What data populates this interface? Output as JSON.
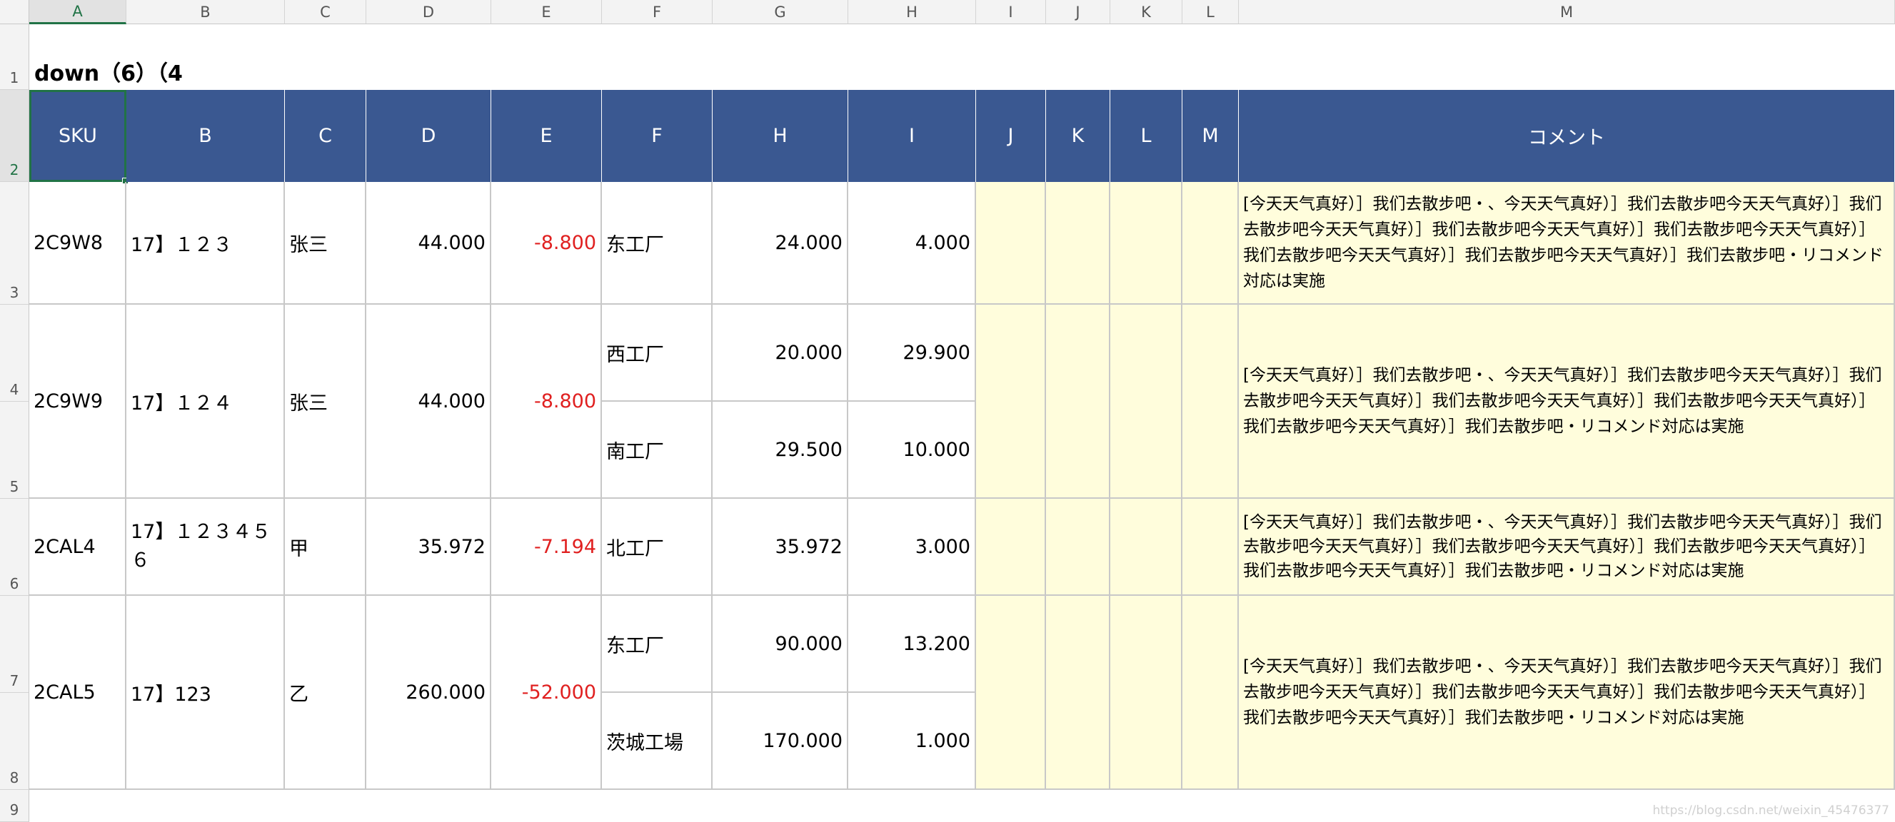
{
  "sheet": {
    "column_letters": [
      "A",
      "B",
      "C",
      "D",
      "E",
      "F",
      "G",
      "H",
      "I",
      "J",
      "K",
      "L",
      "M"
    ],
    "row_numbers": [
      "1",
      "2",
      "3",
      "4",
      "5",
      "6",
      "7",
      "8",
      "9"
    ],
    "title": "down（6）（4",
    "headers": [
      "SKU",
      "B",
      "C",
      "D",
      "E",
      "F",
      "H",
      "I",
      "J",
      "K",
      "L",
      "M",
      "コメント"
    ],
    "rows": [
      {
        "sku": "2C9W8",
        "b": "17】１２３",
        "c": "张三",
        "d": "44.000",
        "e": "-8.800",
        "plants": [
          {
            "f": "东工厂",
            "h": "24.000",
            "i": "4.000"
          }
        ],
        "comment": "[今天天气真好）］我们去散步吧・、今天天气真好）］我们去散步吧今天天气真好）］我们去散步吧今天天气真好）］我们去散步吧今天天气真好）］我们去散步吧今天天气真好）］我们去散步吧今天天气真好）］我们去散步吧今天天气真好）］我们去散步吧・リコメンド対応は実施"
      },
      {
        "sku": "2C9W9",
        "b": "17】１２４",
        "c": "张三",
        "d": "44.000",
        "e": "-8.800",
        "plants": [
          {
            "f": "西工厂",
            "h": "20.000",
            "i": "29.900"
          },
          {
            "f": "南工厂",
            "h": "29.500",
            "i": "10.000"
          }
        ],
        "comment": "[今天天气真好）］我们去散步吧・、今天天气真好）］我们去散步吧今天天气真好）］我们去散步吧今天天气真好）］我们去散步吧今天天气真好）］我们去散步吧今天天气真好）］我们去散步吧今天天气真好）］我们去散步吧・リコメンド対応は実施"
      },
      {
        "sku": "2CAL4",
        "b": "17】１２３４５６",
        "c": "甲",
        "d": "35.972",
        "e": "-7.194",
        "plants": [
          {
            "f": "北工厂",
            "h": "35.972",
            "i": "3.000"
          }
        ],
        "comment": "[今天天气真好）］我们去散步吧・、今天天气真好）］我们去散步吧今天天气真好）］我们去散步吧今天天气真好）］我们去散步吧今天天气真好）］我们去散步吧今天天气真好）］我们去散步吧今天天气真好）］我们去散步吧・リコメンド対応は実施"
      },
      {
        "sku": "2CAL5",
        "b": "17】123",
        "c": "乙",
        "d": "260.000",
        "e": "-52.000",
        "plants": [
          {
            "f": "东工厂",
            "h": "90.000",
            "i": "13.200"
          },
          {
            "f": "茨城工場",
            "h": "170.000",
            "i": "1.000"
          }
        ],
        "comment": "[今天天气真好）］我们去散步吧・、今天天气真好）］我们去散步吧今天天气真好）］我们去散步吧今天天气真好）］我们去散步吧今天天气真好）］我们去散步吧今天天气真好）］我们去散步吧今天天气真好）］我们去散步吧・リコメンド対応は実施"
      }
    ],
    "watermark": "https://blog.csdn.net/weixin_45476377"
  },
  "colors": {
    "header_fill": "#3a5891",
    "negative": "#e02020",
    "highlight": "#fffddc",
    "selection": "#217346"
  }
}
